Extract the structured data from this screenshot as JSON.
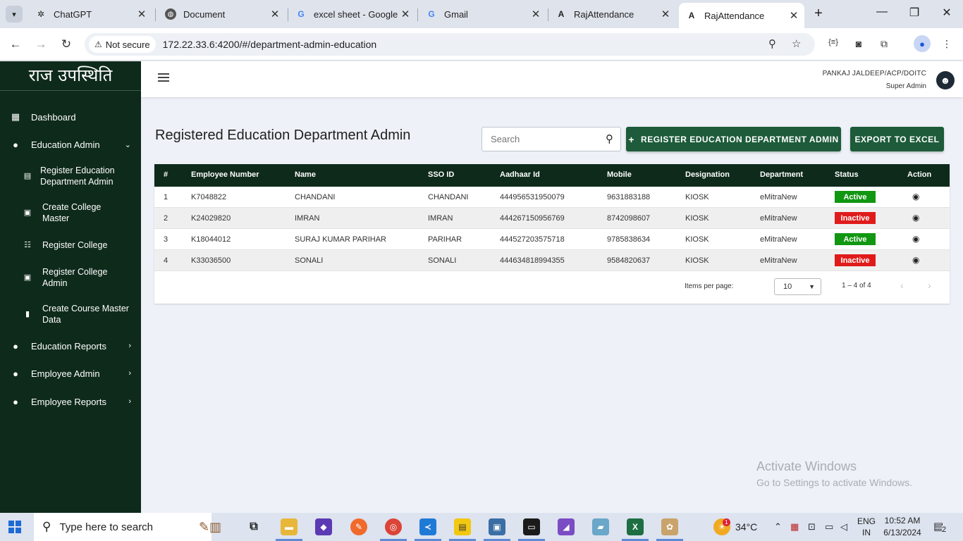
{
  "browser": {
    "tabs": [
      {
        "label": "ChatGPT",
        "favicon": "chatgpt-icon"
      },
      {
        "label": "Document",
        "favicon": "globe-icon"
      },
      {
        "label": "excel sheet - Google",
        "favicon": "google-icon"
      },
      {
        "label": "Gmail",
        "favicon": "google-icon"
      },
      {
        "label": "RajAttendance",
        "favicon": "angular-icon"
      },
      {
        "label": "RajAttendance",
        "favicon": "angular-icon"
      }
    ],
    "security_label": "Not secure",
    "url": "172.22.33.6:4200/#/department-admin-education"
  },
  "sidebar": {
    "brand": "राज उपस्थिति",
    "items": [
      {
        "label": "Dashboard",
        "icon": "dashboard-icon"
      },
      {
        "label": "Education Admin",
        "icon": "person-icon",
        "chevron": "down"
      },
      {
        "label": "Education Reports",
        "icon": "person-icon",
        "chevron": "right"
      },
      {
        "label": "Employee Admin",
        "icon": "person-icon",
        "chevron": "right"
      },
      {
        "label": "Employee Reports",
        "icon": "person-icon",
        "chevron": "right"
      }
    ],
    "sub_items": [
      {
        "label": "Register Education Department Admin"
      },
      {
        "label": "Create College Master"
      },
      {
        "label": "Register College"
      },
      {
        "label": "Register College Admin"
      },
      {
        "label": "Create Course Master Data"
      }
    ]
  },
  "header": {
    "user_name": "PANKAJ JALDEEP/ACP/DOITC",
    "user_role": "Super Admin"
  },
  "main": {
    "title": "Registered Education Department Admin",
    "search_placeholder": "Search",
    "register_button": "REGISTER EDUCATION DEPARTMENT ADMIN",
    "export_button": "EXPORT TO EXCEL",
    "table": {
      "columns": [
        "#",
        "Employee Number",
        "Name",
        "SSO ID",
        "Aadhaar Id",
        "Mobile",
        "Designation",
        "Department",
        "Status",
        "Action"
      ],
      "rows": [
        [
          "1",
          "K7048822",
          "CHANDANI",
          "CHANDANI",
          "444956531950079",
          "9631883188",
          "KIOSK",
          "eMitraNew",
          "Active"
        ],
        [
          "2",
          "K24029820",
          "IMRAN",
          "IMRAN",
          "444267150956769",
          "8742098607",
          "KIOSK",
          "eMitraNew",
          "Inactive"
        ],
        [
          "3",
          "K18044012",
          "SURAJ KUMAR PARIHAR",
          "PARIHAR",
          "444527203575718",
          "9785838634",
          "KIOSK",
          "eMitraNew",
          "Active"
        ],
        [
          "4",
          "K33036500",
          "SONALI",
          "SONALI",
          "444634818994355",
          "9584820637",
          "KIOSK",
          "eMitraNew",
          "Inactive"
        ]
      ]
    },
    "paginator": {
      "items_per_page_label": "Items per page:",
      "page_size": "10",
      "range_label": "1 – 4 of 4"
    }
  },
  "watermark": {
    "line1": "Activate Windows",
    "line2": "Go to Settings to activate Windows."
  },
  "taskbar": {
    "search_placeholder": "Type here to search",
    "weather": "34°C",
    "weather_badge": "1",
    "lang_line1": "ENG",
    "lang_line2": "IN",
    "time": "10:52 AM",
    "date": "6/13/2024",
    "notification_count": "2"
  },
  "colors": {
    "sidebar_bg": "#0e2a1b",
    "button_bg": "#1d5b3a",
    "status_active": "#119711",
    "status_inactive": "#e01b1b"
  }
}
